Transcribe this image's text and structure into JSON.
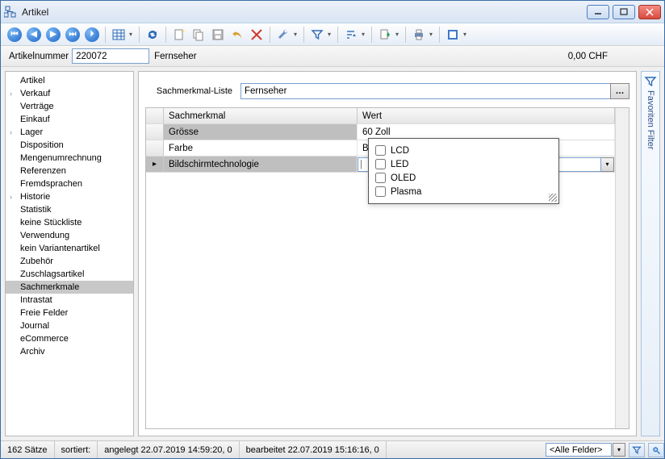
{
  "window": {
    "title": "Artikel"
  },
  "info": {
    "number_label": "Artikelnummer",
    "number": "220072",
    "description": "Fernseher",
    "price": "0,00   CHF"
  },
  "sidebar": {
    "items": [
      {
        "label": "Artikel",
        "expandable": false
      },
      {
        "label": "Verkauf",
        "expandable": true
      },
      {
        "label": "Verträge",
        "expandable": false
      },
      {
        "label": "Einkauf",
        "expandable": false
      },
      {
        "label": "Lager",
        "expandable": true
      },
      {
        "label": "Disposition",
        "expandable": false
      },
      {
        "label": "Mengenumrechnung",
        "expandable": false
      },
      {
        "label": "Referenzen",
        "expandable": false
      },
      {
        "label": "Fremdsprachen",
        "expandable": false
      },
      {
        "label": "Historie",
        "expandable": true
      },
      {
        "label": "Statistik",
        "expandable": false
      },
      {
        "label": "keine Stückliste",
        "expandable": false
      },
      {
        "label": "Verwendung",
        "expandable": false
      },
      {
        "label": "kein Variantenartikel",
        "expandable": false
      },
      {
        "label": "Zubehör",
        "expandable": false
      },
      {
        "label": "Zuschlagsartikel",
        "expandable": false
      },
      {
        "label": "Sachmerkmale",
        "expandable": false,
        "selected": true
      },
      {
        "label": "Intrastat",
        "expandable": false
      },
      {
        "label": "Freie Felder",
        "expandable": false
      },
      {
        "label": "Journal",
        "expandable": false
      },
      {
        "label": "eCommerce",
        "expandable": false
      },
      {
        "label": "Archiv",
        "expandable": false
      }
    ]
  },
  "main": {
    "list_label": "Sachmerkmal-Liste",
    "list_value": "Fernseher",
    "columns": [
      "Sachmerkmal",
      "Wert"
    ],
    "rows": [
      {
        "name": "Grösse",
        "value": "60 Zoll",
        "shaded": true
      },
      {
        "name": "Farbe",
        "value": "Blau"
      },
      {
        "name": "Bildschirmtechnologie",
        "value": "",
        "editing": true,
        "current": true
      }
    ],
    "dropdown_options": [
      "LCD",
      "LED",
      "OLED",
      "Plasma"
    ]
  },
  "right_panel": {
    "label": "Favoriten Filter"
  },
  "status": {
    "count": "162 Sätze",
    "sorted": "sortiert:",
    "created": "angelegt 22.07.2019 14:59:20,  0",
    "modified": "bearbeitet 22.07.2019 15:16:16,  0",
    "combo": "<Alle Felder>"
  }
}
